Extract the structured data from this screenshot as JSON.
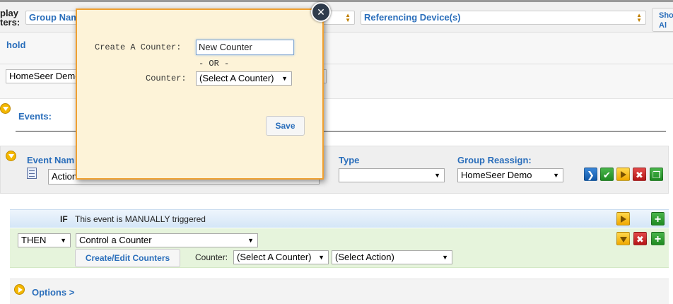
{
  "filter_bar": {
    "label_line1": "play",
    "label_line2": "ters:",
    "group_select": "Group Nam",
    "referencing_select": "Referencing Device(s)",
    "show_all_line1": "Sho",
    "show_all_line2": "Al"
  },
  "group": {
    "title": "hold",
    "name_value": "HomeSeer Demo",
    "events_label": "Events:"
  },
  "event": {
    "name_label": "Event Nam",
    "name_value": "Action",
    "type_label": "Type",
    "type_value": "",
    "reassign_label": "Group Reassign:",
    "reassign_value": "HomeSeer Demo"
  },
  "trigger": {
    "if_label": "IF",
    "text": "This event is MANUALLY triggered"
  },
  "action": {
    "then_value": "THEN",
    "action_value": "Control a Counter",
    "create_edit_label": "Create/Edit Counters",
    "counter_label": "Counter:",
    "counter_value": "(Select A Counter)",
    "action_select_value": "(Select Action)"
  },
  "options": {
    "label": "Options >"
  },
  "modal": {
    "create_label": "Create A Counter:",
    "new_counter_value": "New Counter",
    "or_text": "- OR -",
    "counter_label": "Counter:",
    "counter_select": "(Select A Counter)",
    "save_label": "Save",
    "close_glyph": "✕"
  },
  "colors": {
    "accent_blue": "#2a6ebb",
    "modal_bg": "#fdf3d8",
    "modal_border": "#f0a030",
    "if_bar": "#dbe9f7",
    "then_bar": "#e8f5dc"
  }
}
